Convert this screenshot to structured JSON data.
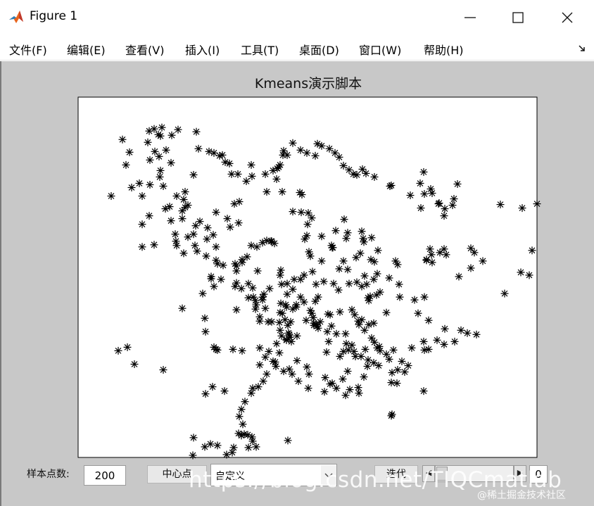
{
  "window": {
    "title": "Figure 1",
    "icon": "matlab-icon"
  },
  "menu": {
    "items": [
      {
        "label": "文件(F)"
      },
      {
        "label": "编辑(E)"
      },
      {
        "label": "查看(V)"
      },
      {
        "label": "插入(I)"
      },
      {
        "label": "工具(T)"
      },
      {
        "label": "桌面(D)"
      },
      {
        "label": "窗口(W)"
      },
      {
        "label": "帮助(H)"
      }
    ]
  },
  "chart_data": {
    "type": "scatter",
    "title": "Kmeans演示脚本",
    "marker": "*",
    "marker_color": "#000000",
    "background": "#ffffff",
    "figure_color": "#c8c8c8",
    "grid": false,
    "xlim": [
      0,
      652
    ],
    "ylim": [
      0,
      510
    ],
    "points": [
      [
        163,
        507
      ],
      [
        164,
        482
      ],
      [
        234,
        463
      ],
      [
        298,
        486
      ],
      [
        445,
        451
      ],
      [
        446,
        449
      ],
      [
        399,
        419
      ],
      [
        491,
        416
      ],
      [
        181,
        420
      ],
      [
        191,
        410
      ],
      [
        208,
        416
      ],
      [
        411,
        381
      ],
      [
        80,
        378
      ],
      [
        57,
        359
      ],
      [
        70,
        354
      ],
      [
        121,
        386
      ],
      [
        181,
        332
      ],
      [
        198,
        358
      ],
      [
        258,
        379
      ],
      [
        280,
        375
      ],
      [
        233,
        359
      ],
      [
        196,
        357
      ],
      [
        193,
        354
      ],
      [
        220,
        357
      ],
      [
        353,
        361
      ],
      [
        377,
        360
      ],
      [
        381,
        349
      ],
      [
        384,
        358
      ],
      [
        408,
        357
      ],
      [
        425,
        355
      ],
      [
        354,
        332
      ],
      [
        311,
        338
      ],
      [
        299,
        334
      ],
      [
        367,
        335
      ],
      [
        380,
        335
      ],
      [
        360,
        324
      ],
      [
        429,
        359
      ],
      [
        460,
        374
      ],
      [
        474,
        355
      ],
      [
        498,
        357
      ],
      [
        491,
        346
      ],
      [
        520,
        350
      ],
      [
        521,
        328
      ],
      [
        535,
        346
      ],
      [
        544,
        330
      ],
      [
        553,
        334
      ],
      [
        566,
        336
      ],
      [
        483,
        306
      ],
      [
        492,
        283
      ],
      [
        438,
        305
      ],
      [
        415,
        282
      ],
      [
        429,
        276
      ],
      [
        457,
        283
      ],
      [
        478,
        287
      ],
      [
        456,
        265
      ],
      [
        412,
        284
      ],
      [
        403,
        268
      ],
      [
        396,
        262
      ],
      [
        385,
        264
      ],
      [
        370,
        273
      ],
      [
        363,
        264
      ],
      [
        338,
        265
      ],
      [
        349,
        261
      ],
      [
        321,
        290
      ],
      [
        310,
        297
      ],
      [
        305,
        272
      ],
      [
        297,
        279
      ],
      [
        295,
        294
      ],
      [
        262,
        287
      ],
      [
        253,
        294
      ],
      [
        252,
        300
      ],
      [
        258,
        311
      ],
      [
        180,
        313
      ],
      [
        148,
        299
      ],
      [
        177,
        278
      ],
      [
        193,
        268
      ],
      [
        189,
        257
      ],
      [
        203,
        258
      ],
      [
        223,
        268
      ],
      [
        225,
        263
      ],
      [
        232,
        271
      ],
      [
        242,
        284
      ],
      [
        249,
        283
      ],
      [
        248,
        270
      ],
      [
        287,
        305
      ],
      [
        296,
        297
      ],
      [
        288,
        292
      ],
      [
        275,
        318
      ],
      [
        324,
        316
      ],
      [
        289,
        338
      ],
      [
        296,
        344
      ],
      [
        301,
        340
      ],
      [
        305,
        300
      ],
      [
        290,
        306
      ],
      [
        294,
        315
      ],
      [
        298,
        323
      ],
      [
        287,
        330
      ],
      [
        288,
        245
      ],
      [
        287,
        252
      ],
      [
        297,
        264
      ],
      [
        307,
        258
      ],
      [
        316,
        258
      ],
      [
        321,
        252
      ],
      [
        333,
        247
      ],
      [
        330,
        225
      ],
      [
        328,
        219
      ],
      [
        322,
        201
      ],
      [
        346,
        232
      ],
      [
        362,
        213
      ],
      [
        377,
        232
      ],
      [
        383,
        244
      ],
      [
        395,
        227
      ],
      [
        407,
        253
      ],
      [
        406,
        205
      ],
      [
        401,
        221
      ],
      [
        416,
        230
      ],
      [
        421,
        233
      ],
      [
        425,
        250
      ],
      [
        420,
        258
      ],
      [
        442,
        256
      ],
      [
        451,
        232
      ],
      [
        454,
        237
      ],
      [
        424,
        280
      ],
      [
        426,
        217
      ],
      [
        417,
        199
      ],
      [
        405,
        200
      ],
      [
        403,
        190
      ],
      [
        383,
        192
      ],
      [
        366,
        189
      ],
      [
        378,
        173
      ],
      [
        381,
        200
      ],
      [
        325,
        196
      ],
      [
        326,
        180
      ],
      [
        332,
        171
      ],
      [
        317,
        163
      ],
      [
        327,
        164
      ],
      [
        318,
        138
      ],
      [
        315,
        135
      ],
      [
        305,
        162
      ],
      [
        290,
        134
      ],
      [
        282,
        116
      ],
      [
        285,
        99
      ],
      [
        283,
        101
      ],
      [
        246,
        96
      ],
      [
        239,
        119
      ],
      [
        229,
        148
      ],
      [
        222,
        151
      ],
      [
        228,
        178
      ],
      [
        216,
        184
      ],
      [
        212,
        172
      ],
      [
        196,
        163
      ],
      [
        192,
        195
      ],
      [
        196,
        212
      ],
      [
        182,
        225
      ],
      [
        206,
        238
      ],
      [
        225,
        239
      ],
      [
        255,
        246
      ],
      [
        242,
        264
      ],
      [
        225,
        246
      ],
      [
        223,
        236
      ],
      [
        233,
        234
      ],
      [
        138,
        194
      ],
      [
        164,
        194
      ],
      [
        167,
        182
      ],
      [
        148,
        161
      ],
      [
        148,
        172
      ],
      [
        156,
        153
      ],
      [
        152,
        134
      ],
      [
        130,
        155
      ],
      [
        132,
        175
      ],
      [
        139,
        204
      ],
      [
        156,
        198
      ],
      [
        166,
        210
      ],
      [
        183,
        201
      ],
      [
        198,
        236
      ],
      [
        169,
        218
      ],
      [
        140,
        210
      ],
      [
        108,
        209
      ],
      [
        91,
        212
      ],
      [
        47,
        140
      ],
      [
        68,
        96
      ],
      [
        76,
        128
      ],
      [
        91,
        140
      ],
      [
        102,
        124
      ],
      [
        87,
        122
      ],
      [
        121,
        126
      ],
      [
        116,
        113
      ],
      [
        132,
        93
      ],
      [
        117,
        104
      ],
      [
        102,
        89
      ],
      [
        115,
        84
      ],
      [
        109,
        77
      ],
      [
        125,
        75
      ],
      [
        133,
        54
      ],
      [
        117,
        55
      ],
      [
        114,
        53
      ],
      [
        108,
        45
      ],
      [
        101,
        48
      ],
      [
        63,
        60
      ],
      [
        73,
        78
      ],
      [
        99,
        64
      ],
      [
        119,
        43
      ],
      [
        142,
        46
      ],
      [
        168,
        49
      ],
      [
        171,
        73
      ],
      [
        186,
        77
      ],
      [
        193,
        79
      ],
      [
        201,
        83
      ],
      [
        205,
        82
      ],
      [
        209,
        92
      ],
      [
        215,
        94
      ],
      [
        218,
        109
      ],
      [
        227,
        109
      ],
      [
        247,
        112
      ],
      [
        268,
        134
      ],
      [
        266,
        109
      ],
      [
        277,
        104
      ],
      [
        287,
        96
      ],
      [
        291,
        82
      ],
      [
        297,
        82
      ],
      [
        292,
        76
      ],
      [
        305,
        65
      ],
      [
        316,
        75
      ],
      [
        325,
        79
      ],
      [
        337,
        83
      ],
      [
        340,
        66
      ],
      [
        346,
        69
      ],
      [
        357,
        73
      ],
      [
        365,
        79
      ],
      [
        371,
        85
      ],
      [
        377,
        97
      ],
      [
        385,
        103
      ],
      [
        391,
        109
      ],
      [
        396,
        110
      ],
      [
        404,
        102
      ],
      [
        409,
        108
      ],
      [
        421,
        113
      ],
      [
        443,
        126
      ],
      [
        445,
        125
      ],
      [
        472,
        139
      ],
      [
        491,
        106
      ],
      [
        486,
        122
      ],
      [
        492,
        137
      ],
      [
        501,
        130
      ],
      [
        512,
        151
      ],
      [
        521,
        158
      ],
      [
        513,
        150
      ],
      [
        487,
        157
      ],
      [
        503,
        136
      ],
      [
        520,
        168
      ],
      [
        532,
        153
      ],
      [
        539,
        123
      ],
      [
        600,
        152
      ],
      [
        631,
        157
      ],
      [
        652,
        151
      ],
      [
        534,
        144
      ],
      [
        495,
        230
      ],
      [
        500,
        215
      ],
      [
        502,
        223
      ],
      [
        495,
        231
      ],
      [
        503,
        234
      ],
      [
        514,
        220
      ],
      [
        520,
        215
      ],
      [
        523,
        223
      ],
      [
        541,
        254
      ],
      [
        606,
        278
      ],
      [
        629,
        248
      ],
      [
        641,
        252
      ],
      [
        655,
        239
      ],
      [
        645,
        217
      ],
      [
        575,
        232
      ],
      [
        558,
        242
      ],
      [
        563,
        220
      ],
      [
        558,
        214
      ],
      [
        498,
        316
      ],
      [
        510,
        344
      ],
      [
        492,
        358
      ],
      [
        469,
        380
      ],
      [
        438,
        364
      ],
      [
        448,
        358
      ],
      [
        442,
        371
      ],
      [
        412,
        372
      ],
      [
        392,
        360
      ],
      [
        372,
        367
      ],
      [
        403,
        315
      ],
      [
        413,
        288
      ],
      [
        410,
        265
      ],
      [
        371,
        243
      ],
      [
        361,
        213
      ],
      [
        360,
        210
      ],
      [
        346,
        197
      ],
      [
        262,
        206
      ],
      [
        274,
        204
      ],
      [
        275,
        204
      ],
      [
        279,
        207
      ],
      [
        268,
        203
      ],
      [
        254,
        212
      ],
      [
        246,
        210
      ],
      [
        240,
        226
      ],
      [
        233,
        230
      ],
      [
        189,
        254
      ],
      [
        196,
        231
      ],
      [
        184,
        185
      ],
      [
        173,
        176
      ],
      [
        152,
        156
      ],
      [
        101,
        168
      ],
      [
        91,
        180
      ],
      [
        140,
        140
      ],
      [
        150,
        145
      ],
      [
        164,
        110
      ],
      [
        124,
        158
      ],
      [
        150,
        221
      ],
      [
        225,
        301
      ],
      [
        258,
        317
      ],
      [
        266,
        299
      ],
      [
        335,
        320
      ],
      [
        338,
        322
      ],
      [
        335,
        323
      ],
      [
        340,
        324
      ],
      [
        341,
        327
      ],
      [
        356,
        346
      ],
      [
        389,
        351
      ],
      [
        421,
        347
      ],
      [
        428,
        353
      ],
      [
        417,
        341
      ],
      [
        407,
        330
      ],
      [
        398,
        317
      ],
      [
        399,
        322
      ],
      [
        413,
        322
      ],
      [
        420,
        320
      ],
      [
        393,
        308
      ],
      [
        389,
        301
      ],
      [
        372,
        304
      ],
      [
        358,
        308
      ],
      [
        355,
        307
      ],
      [
        344,
        318
      ],
      [
        334,
        312
      ],
      [
        332,
        306
      ],
      [
        330,
        302
      ],
      [
        337,
        289
      ],
      [
        341,
        283
      ],
      [
        316,
        283
      ],
      [
        310,
        294
      ],
      [
        289,
        265
      ],
      [
        272,
        271
      ],
      [
        264,
        279
      ],
      [
        262,
        283
      ],
      [
        252,
        288
      ],
      [
        270,
        318
      ],
      [
        302,
        318
      ],
      [
        286,
        319
      ],
      [
        296,
        343
      ],
      [
        303,
        346
      ],
      [
        300,
        336
      ],
      [
        282,
        349
      ],
      [
        258,
        355
      ],
      [
        271,
        360
      ],
      [
        266,
        368
      ],
      [
        277,
        374
      ],
      [
        286,
        362
      ],
      [
        311,
        373
      ],
      [
        325,
        382
      ],
      [
        328,
        392
      ],
      [
        351,
        397
      ],
      [
        358,
        406
      ],
      [
        367,
        412
      ],
      [
        380,
        422
      ],
      [
        386,
        414
      ],
      [
        398,
        411
      ],
      [
        406,
        396
      ],
      [
        383,
        388
      ],
      [
        394,
        367
      ],
      [
        402,
        367
      ],
      [
        420,
        376
      ],
      [
        446,
        390
      ],
      [
        454,
        386
      ],
      [
        464,
        389
      ],
      [
        453,
        405
      ],
      [
        445,
        404
      ],
      [
        427,
        380
      ],
      [
        376,
        399
      ],
      [
        361,
        405
      ],
      [
        350,
        417
      ],
      [
        327,
        412
      ],
      [
        313,
        402
      ],
      [
        304,
        392
      ],
      [
        300,
        385
      ],
      [
        292,
        388
      ],
      [
        281,
        381
      ],
      [
        268,
        392
      ],
      [
        263,
        402
      ],
      [
        256,
        410
      ],
      [
        248,
        412
      ],
      [
        246,
        419
      ],
      [
        237,
        431
      ],
      [
        232,
        442
      ],
      [
        229,
        452
      ],
      [
        228,
        476
      ],
      [
        232,
        479
      ],
      [
        236,
        477
      ],
      [
        241,
        478
      ],
      [
        247,
        481
      ],
      [
        248,
        487
      ],
      [
        253,
        495
      ],
      [
        242,
        496
      ],
      [
        221,
        496
      ],
      [
        219,
        503
      ],
      [
        211,
        506
      ],
      [
        198,
        493
      ],
      [
        188,
        491
      ],
      [
        180,
        495
      ]
    ]
  },
  "controls": {
    "sample_label": "样本点数:",
    "sample_value": "200",
    "center_button": "中心点",
    "center_select": "自定义",
    "iterate_button": "迭代",
    "iterate_value": "0",
    "slider_left_arrow": "◀",
    "slider_right_arrow": "▶",
    "slider_level": 0
  },
  "watermark": {
    "main": "https://blog.csdn.net/TIQCmatlab",
    "small": "@稀土掘金技术社区"
  }
}
